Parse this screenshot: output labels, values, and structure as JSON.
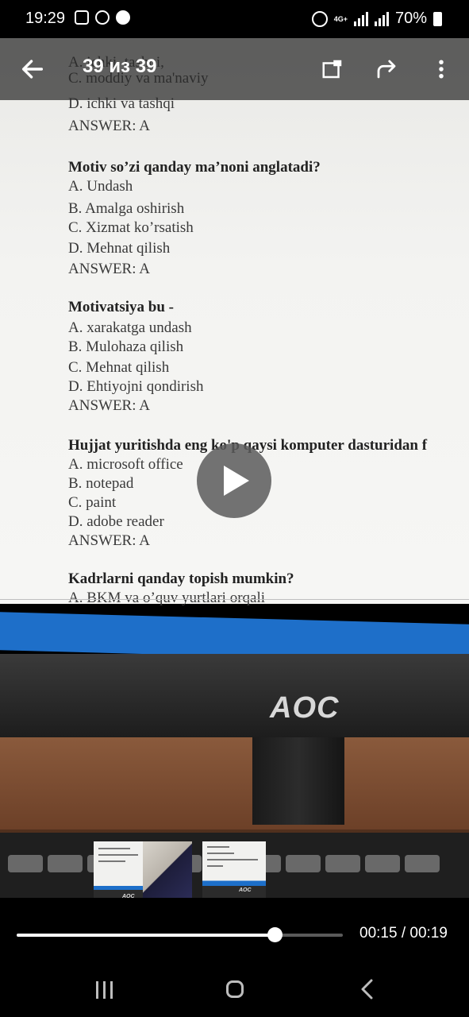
{
  "status_bar": {
    "time": "19:29",
    "network": "4G+",
    "battery": "70%",
    "icons": [
      "image-icon",
      "bubble-icon",
      "sync-icon",
      "alarm-icon",
      "signal-icon",
      "signal-icon",
      "battery-icon"
    ]
  },
  "app_bar": {
    "title": "39 из 39",
    "icons": [
      "back-arrow-icon",
      "open-window-icon",
      "share-forward-icon",
      "more-vert-icon"
    ]
  },
  "document": {
    "lines": [
      {
        "text": "A. ichki, tashqi,",
        "kind": "option"
      },
      {
        "text": "C. moddiy va ma'naviy",
        "kind": "option"
      },
      {
        "text": "D. ichki va tashqi",
        "kind": "option"
      },
      {
        "text": "ANSWER: A",
        "kind": "answer"
      },
      {
        "text": "Motiv so’zi qanday ma’noni anglatadi?",
        "kind": "question"
      },
      {
        "text": "A. Undash",
        "kind": "option"
      },
      {
        "text": "B. Amalga oshirish",
        "kind": "option"
      },
      {
        "text": "C. Xizmat ko’rsatish",
        "kind": "option"
      },
      {
        "text": "D. Mehnat qilish",
        "kind": "option"
      },
      {
        "text": "ANSWER: A",
        "kind": "answer"
      },
      {
        "text": "Motivatsiya bu -",
        "kind": "question"
      },
      {
        "text": "A. xarakatga undash",
        "kind": "option"
      },
      {
        "text": "B. Mulohaza qilish",
        "kind": "option"
      },
      {
        "text": "C. Mehnat qilish",
        "kind": "option"
      },
      {
        "text": "D. Ehtiyojni qondirish",
        "kind": "option"
      },
      {
        "text": "ANSWER: A",
        "kind": "answer"
      },
      {
        "text": "Hujjat yuritishda eng ko'p qaysi komputer dasturidan f",
        "kind": "question"
      },
      {
        "text": "A. microsoft office",
        "kind": "option"
      },
      {
        "text": "B. notepad",
        "kind": "option"
      },
      {
        "text": "C. paint",
        "kind": "option"
      },
      {
        "text": "D. adobe reader",
        "kind": "option"
      },
      {
        "text": "ANSWER: A",
        "kind": "answer"
      },
      {
        "text": "Kadrlarni qanday topish mumkin?",
        "kind": "question"
      },
      {
        "text": "A. BKM va o’quv yurtlari orqali",
        "kind": "option"
      }
    ],
    "monitor_logo": "AOC"
  },
  "video": {
    "progress": 0.79,
    "elapsed": "00:15",
    "duration": "00:19",
    "time_display": "00:15 / 00:19"
  },
  "thumbnails": {
    "count": 3,
    "logo_text": "AOC"
  },
  "nav_bar": {
    "icons": [
      "recent-apps-icon",
      "home-icon",
      "back-icon"
    ]
  },
  "colors": {
    "taskbar_blue": "#1e6fc9",
    "app_bar_bg": "#282828",
    "progress_fill": "#ffffff",
    "progress_track": "#5a5a5a"
  }
}
